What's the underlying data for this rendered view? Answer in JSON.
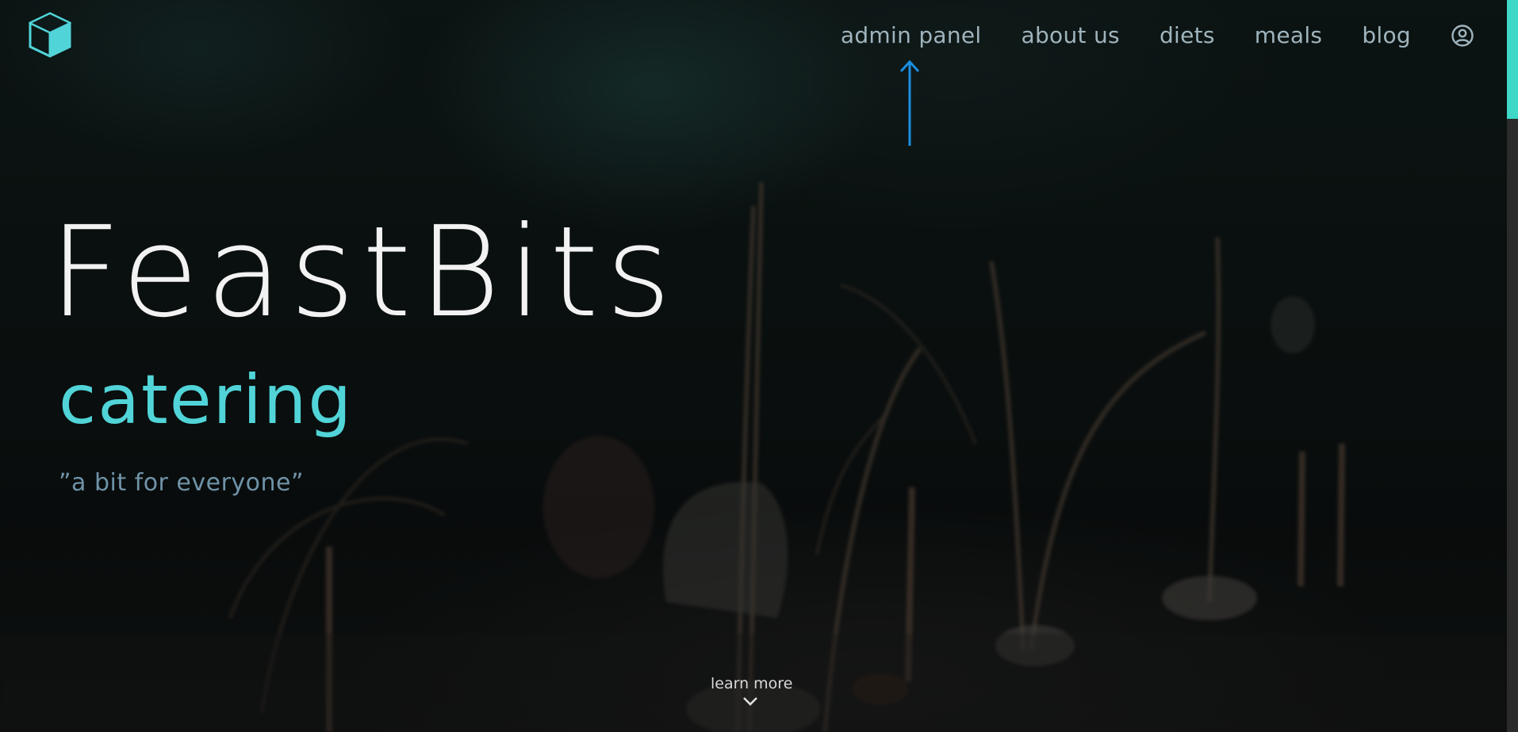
{
  "brand": {
    "logo_icon": "cube-icon",
    "accent_color": "#51d4d8"
  },
  "nav": {
    "items": [
      {
        "label": "admin panel"
      },
      {
        "label": "about us"
      },
      {
        "label": "diets"
      },
      {
        "label": "meals"
      },
      {
        "label": "blog"
      }
    ],
    "user_icon": "user-circle-icon"
  },
  "annotation": {
    "icon": "arrow-up-icon",
    "color": "#1a8fe0"
  },
  "hero": {
    "title": "FeastBits",
    "subtitle": "catering",
    "tagline": "”a bit for everyone”"
  },
  "learn_more": {
    "label": "learn more",
    "icon": "chevron-down-icon"
  },
  "scrollbar": {
    "thumb_color": "#3fd8c6"
  }
}
